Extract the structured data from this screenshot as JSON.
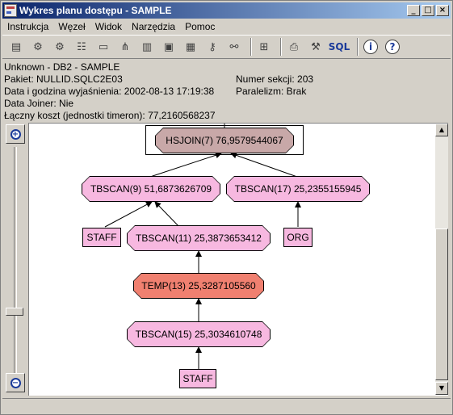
{
  "window": {
    "title": "Wykres planu dostępu - SAMPLE",
    "minimize": "_",
    "maximize": "□",
    "close": "×"
  },
  "menu": [
    "Instrukcja",
    "Węzeł",
    "Widok",
    "Narzędzia",
    "Pomoc"
  ],
  "toolbar": {
    "icons": [
      "statement-icon",
      "node-details-icon",
      "node-details2-icon",
      "tree-icon",
      "sql-text-icon",
      "graph-icon",
      "table-icon",
      "monitor-icon",
      "note-icon",
      "key-icon",
      "network-icon",
      "back-icon",
      "properties-icon",
      "print-icon",
      "tools-icon",
      "sql-icon",
      "info-icon",
      "help-icon"
    ],
    "sql_label": "SQL",
    "info_label": "i",
    "help_label": "?"
  },
  "info": {
    "line1": "Unknown - DB2 - SAMPLE",
    "package": "Pakiet: NULLID.SQLC2E03",
    "explain_time": "Data i godzina wyjaśnienia: 2002-08-13 17:19:38",
    "data_joiner": "Data Joiner: Nie",
    "total_cost": "Łączny koszt (jednostki timeron): 77,2160568237",
    "section": "Numer sekcji: 203",
    "parallelism": "Paralelizm: Brak"
  },
  "colors": {
    "hsjoin": "#c8a8a8",
    "tbscan": "#f7b8e0",
    "temp": "#f08070",
    "table": "#f7b8e0"
  },
  "graph": {
    "nodes": {
      "hsjoin": "HSJOIN(7) 76,9579544067",
      "tbscan9": "TBSCAN(9) 51,6873626709",
      "tbscan17": "TBSCAN(17) 25,2355155945",
      "tbscan11": "TBSCAN(11) 25,3873653412",
      "temp13": "TEMP(13) 25,3287105560",
      "tbscan15": "TBSCAN(15) 25,3034610748"
    },
    "tables": {
      "staff1": "STAFF",
      "org": "ORG",
      "staff2": "STAFF"
    }
  },
  "zoom": {
    "in": "+",
    "out": "−",
    "level": 0.27
  }
}
